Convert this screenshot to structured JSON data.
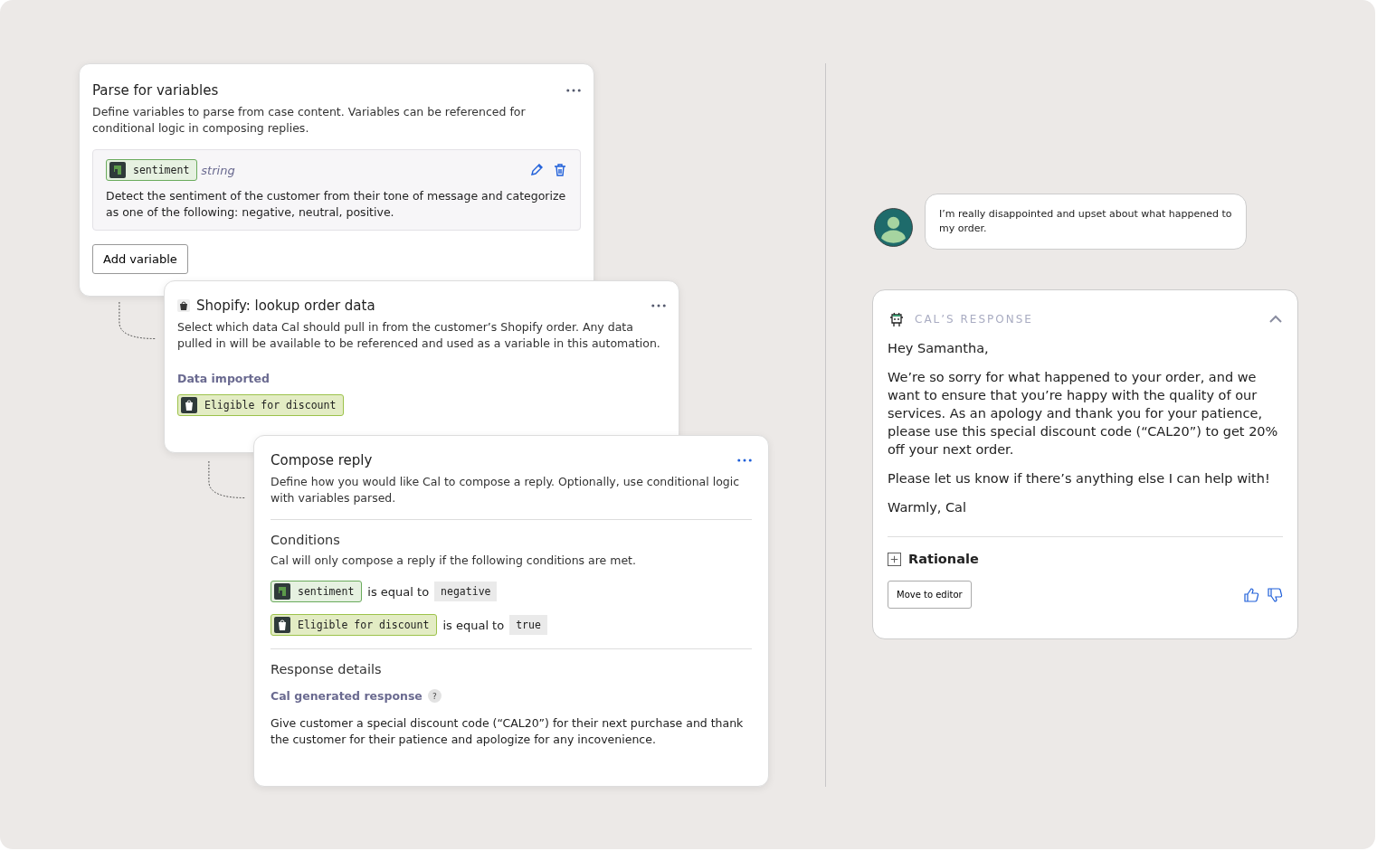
{
  "parse_card": {
    "title": "Parse for variables",
    "description": "Define variables to parse from case content. Variables can be referenced for conditional logic in composing replies.",
    "variables": [
      {
        "name": "sentiment",
        "kind": "variable",
        "type": "string",
        "description": "Detect the sentiment of the customer from their tone of message and categorize as one of the following: negative, neutral, positive."
      }
    ],
    "add_button": "Add variable"
  },
  "shopify_card": {
    "title": "Shopify: lookup order data",
    "description": "Select which data Cal should pull in from the customer’s Shopify order. Any data pulled in will be available to be referenced and used as a variable in this automation.",
    "section_label": "Data imported",
    "chips": [
      {
        "name": "Eligible for discount",
        "kind": "shopify"
      }
    ]
  },
  "compose_card": {
    "title": "Compose reply",
    "description": "Define how you would like Cal to compose a reply. Optionally, use conditional logic with variables parsed.",
    "conditions_title": "Conditions",
    "conditions_description": "Cal will only compose a reply if the following conditions are met.",
    "conditions": [
      {
        "variable": "sentiment",
        "kind": "variable",
        "operator": "is equal to",
        "value": "negative"
      },
      {
        "variable": "Eligible for discount",
        "kind": "shopify",
        "operator": "is equal to",
        "value": "true"
      }
    ],
    "response_title": "Response details",
    "response_label": "Cal generated response",
    "help": "?",
    "response_text": "Give customer a special discount code (“CAL20”) for their next purchase and thank the customer for their patience and apologize for any incovenience."
  },
  "chat": {
    "customer_message": "I’m really disappointed and upset about what happened to my order.",
    "response_header": "CAL’S RESPONSE",
    "expanded": true,
    "paragraphs": [
      "Hey Samantha,",
      "We’re so sorry for what happened to your order, and we want to ensure that you’re happy with the quality of our services. As an apology and thank you for your patience, please use this special discount code (“CAL20”) to get 20% off your next order.",
      "Please let us know if there’s anything else I can help with!",
      "Warmly, Cal"
    ],
    "rationale": "Rationale",
    "move_button": "Move to editor"
  }
}
